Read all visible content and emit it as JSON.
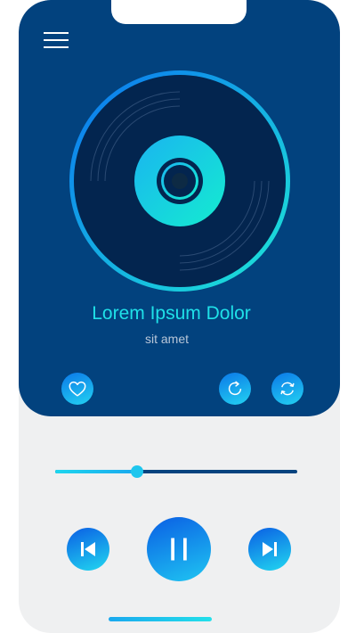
{
  "player": {
    "title": "Lorem Ipsum Dolor",
    "subtitle": "sit amet",
    "progress_fraction": 0.34
  },
  "icons": {
    "menu": "hamburger-menu-icon",
    "favorite": "heart-icon",
    "repeat": "repeat-icon",
    "shuffle": "sync-icon",
    "previous": "skip-previous-icon",
    "play_pause": "pause-icon",
    "next": "skip-next-icon"
  },
  "colors": {
    "panel": "#02427e",
    "accent_cyan": "#1fe0e8",
    "accent_blue": "#0b78e8",
    "background": "#eff0f1"
  }
}
